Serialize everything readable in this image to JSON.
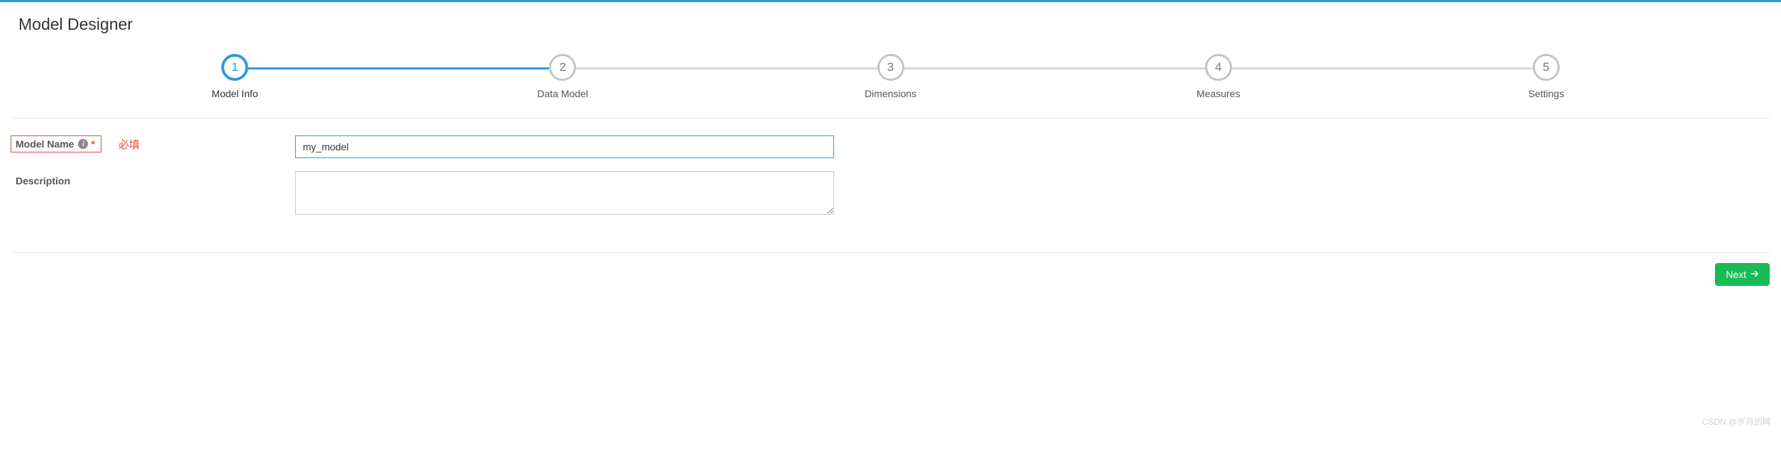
{
  "header": {
    "title": "Model Designer"
  },
  "stepper": {
    "steps": [
      {
        "num": "1",
        "label": "Model Info",
        "active": true
      },
      {
        "num": "2",
        "label": "Data Model",
        "active": false
      },
      {
        "num": "3",
        "label": "Dimensions",
        "active": false
      },
      {
        "num": "4",
        "label": "Measures",
        "active": false
      },
      {
        "num": "5",
        "label": "Settings",
        "active": false
      }
    ]
  },
  "form": {
    "model_name": {
      "label": "Model Name",
      "required_mark": "*",
      "annotation": "必填",
      "value": "my_model"
    },
    "description": {
      "label": "Description",
      "value": ""
    }
  },
  "footer": {
    "next_label": "Next"
  },
  "watermark": "CSDN @岁月的眸"
}
